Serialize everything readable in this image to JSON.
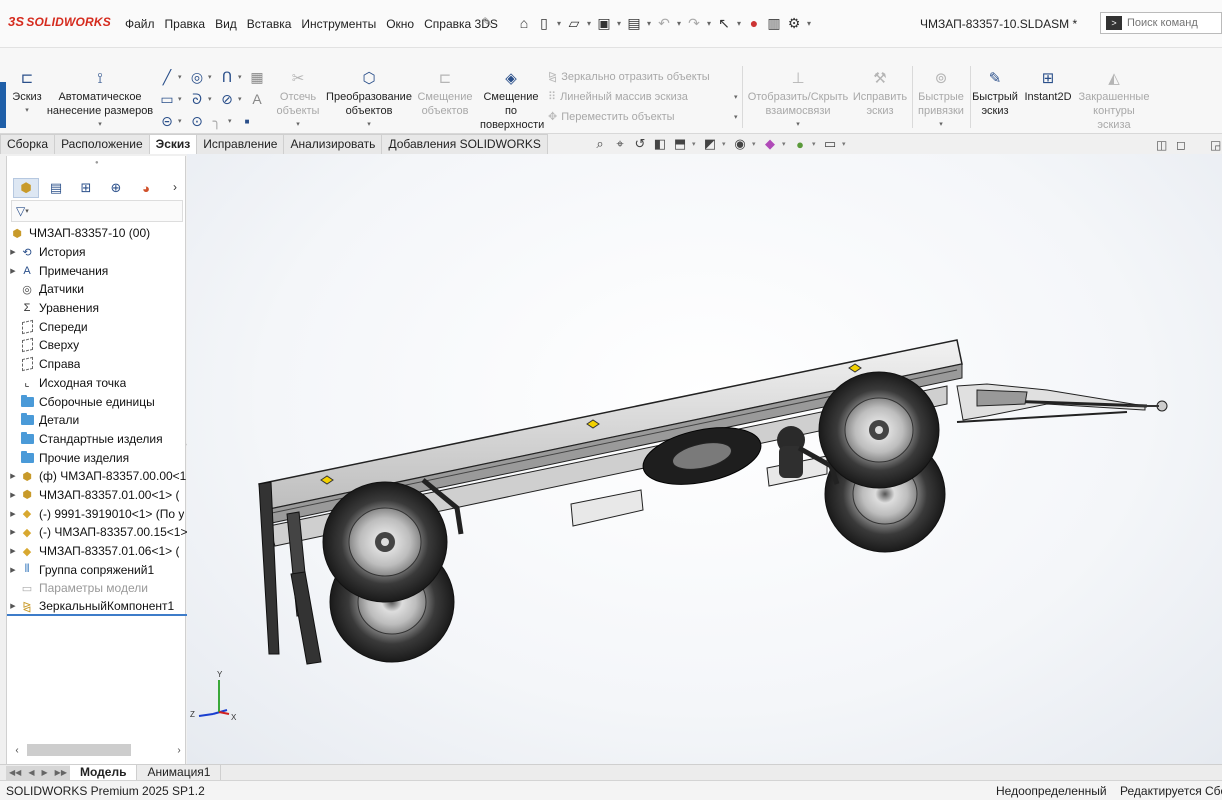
{
  "app": {
    "brand_prefix": "3S",
    "brand_name": "SOLIDWORKS"
  },
  "menu": [
    "Файл",
    "Правка",
    "Вид",
    "Вставка",
    "Инструменты",
    "Окно",
    "Справка 3DS"
  ],
  "title": {
    "document": "ЧМЗАП-83357-10.SLDASM *"
  },
  "search": {
    "placeholder": "Поиск команд"
  },
  "ribbon": {
    "sketch": "Эскиз",
    "smart_dimension": "Автоматическое нанесение размеров",
    "trim": "Отсечь объекты",
    "convert": "Преобразование объектов",
    "offset": "Смещение объектов",
    "offset_surface": "Смещение по поверхности",
    "mirror": "Зеркально отразить объекты",
    "linear_pattern": "Линейный массив эскиза",
    "move": "Переместить объекты",
    "relations": "Отобразить/Скрыть взаимосвязи",
    "repair": "Исправить эскиз",
    "snaps": "Быстрые привязки",
    "rapid_sketch": "Быстрый эскиз",
    "instant2d": "Instant2D",
    "shaded_contours": "Закрашенные контуры эскиза"
  },
  "tabs": [
    "Сборка",
    "Расположение",
    "Эскиз",
    "Исправление",
    "Анализировать",
    "Добавления SOLIDWORKS"
  ],
  "active_tab": "Эскиз",
  "tree": {
    "root": "ЧМЗАП-83357-10 (00)",
    "items": [
      {
        "label": "История",
        "icon": "history-icon",
        "expand": true
      },
      {
        "label": "Примечания",
        "icon": "annotations-icon",
        "expand": true
      },
      {
        "label": "Датчики",
        "icon": "sensors-icon",
        "expand": false
      },
      {
        "label": "Уравнения",
        "icon": "equations-icon",
        "expand": false
      },
      {
        "label": "Спереди",
        "icon": "plane-icon",
        "expand": false
      },
      {
        "label": "Сверху",
        "icon": "plane-icon",
        "expand": false
      },
      {
        "label": "Справа",
        "icon": "plane-icon",
        "expand": false
      },
      {
        "label": "Исходная точка",
        "icon": "origin-icon",
        "expand": false
      },
      {
        "label": "Сборочные единицы",
        "icon": "folder-icon",
        "expand": false
      },
      {
        "label": "Детали",
        "icon": "folder-icon",
        "expand": false
      },
      {
        "label": "Стандартные изделия",
        "icon": "folder-icon",
        "expand": false
      },
      {
        "label": "Прочие изделия",
        "icon": "folder-icon",
        "expand": false
      },
      {
        "label": "(ф) ЧМЗАП-83357.00.00<1",
        "icon": "assembly-icon",
        "expand": true
      },
      {
        "label": "ЧМЗАП-83357.01.00<1> (",
        "icon": "assembly-icon",
        "expand": true
      },
      {
        "label": "(-) 9991-3919010<1> (По у",
        "icon": "part-icon",
        "expand": true
      },
      {
        "label": "(-) ЧМЗАП-83357.00.15<1>",
        "icon": "part-icon",
        "expand": true
      },
      {
        "label": "ЧМЗАП-83357.01.06<1> (",
        "icon": "part-icon",
        "expand": true
      },
      {
        "label": "Группа сопряжений1",
        "icon": "mates-icon",
        "expand": true
      },
      {
        "label": "Параметры модели",
        "icon": "params-icon",
        "expand": false,
        "dim": true
      },
      {
        "label": "ЗеркальныйКомпонент1",
        "icon": "mirror-component-icon",
        "expand": true
      }
    ]
  },
  "triad": {
    "x": "X",
    "y": "Y",
    "z": "Z"
  },
  "bottom_tabs": [
    "Модель",
    "Анимация1"
  ],
  "status": {
    "product": "SOLIDWORKS Premium 2025 SP1.2",
    "state": "Недоопределенный",
    "editing": "Редактируется Сбор"
  },
  "colors": {
    "accent": "#1f5fa8",
    "brand": "#d52b1e"
  }
}
